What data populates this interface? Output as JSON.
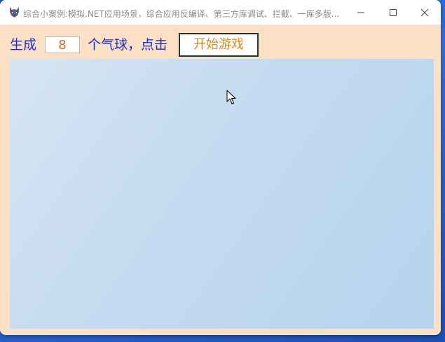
{
  "window": {
    "title": "综合小案例:模拟.NET应用场景，综合应用反编译、第三方库调试、拦截、一库多版..."
  },
  "toolbar": {
    "label_generate": "生成",
    "count_value": "8",
    "label_balloons_click": "个气球，点击",
    "start_button_label": "开始游戏"
  },
  "icons": {
    "app": "wolf-app-icon",
    "minimize": "minimize-icon",
    "maximize": "maximize-icon",
    "close": "close-icon",
    "cursor": "mouse-pointer-icon"
  },
  "colors": {
    "window_background": "#fbe0c4",
    "label_text": "#1f2bd2",
    "count_text": "#e0661c",
    "button_text": "#e0871f",
    "button_border": "#1e3a25",
    "game_area_start": "#d6e5f4",
    "game_area_end": "#b6d3ef"
  }
}
